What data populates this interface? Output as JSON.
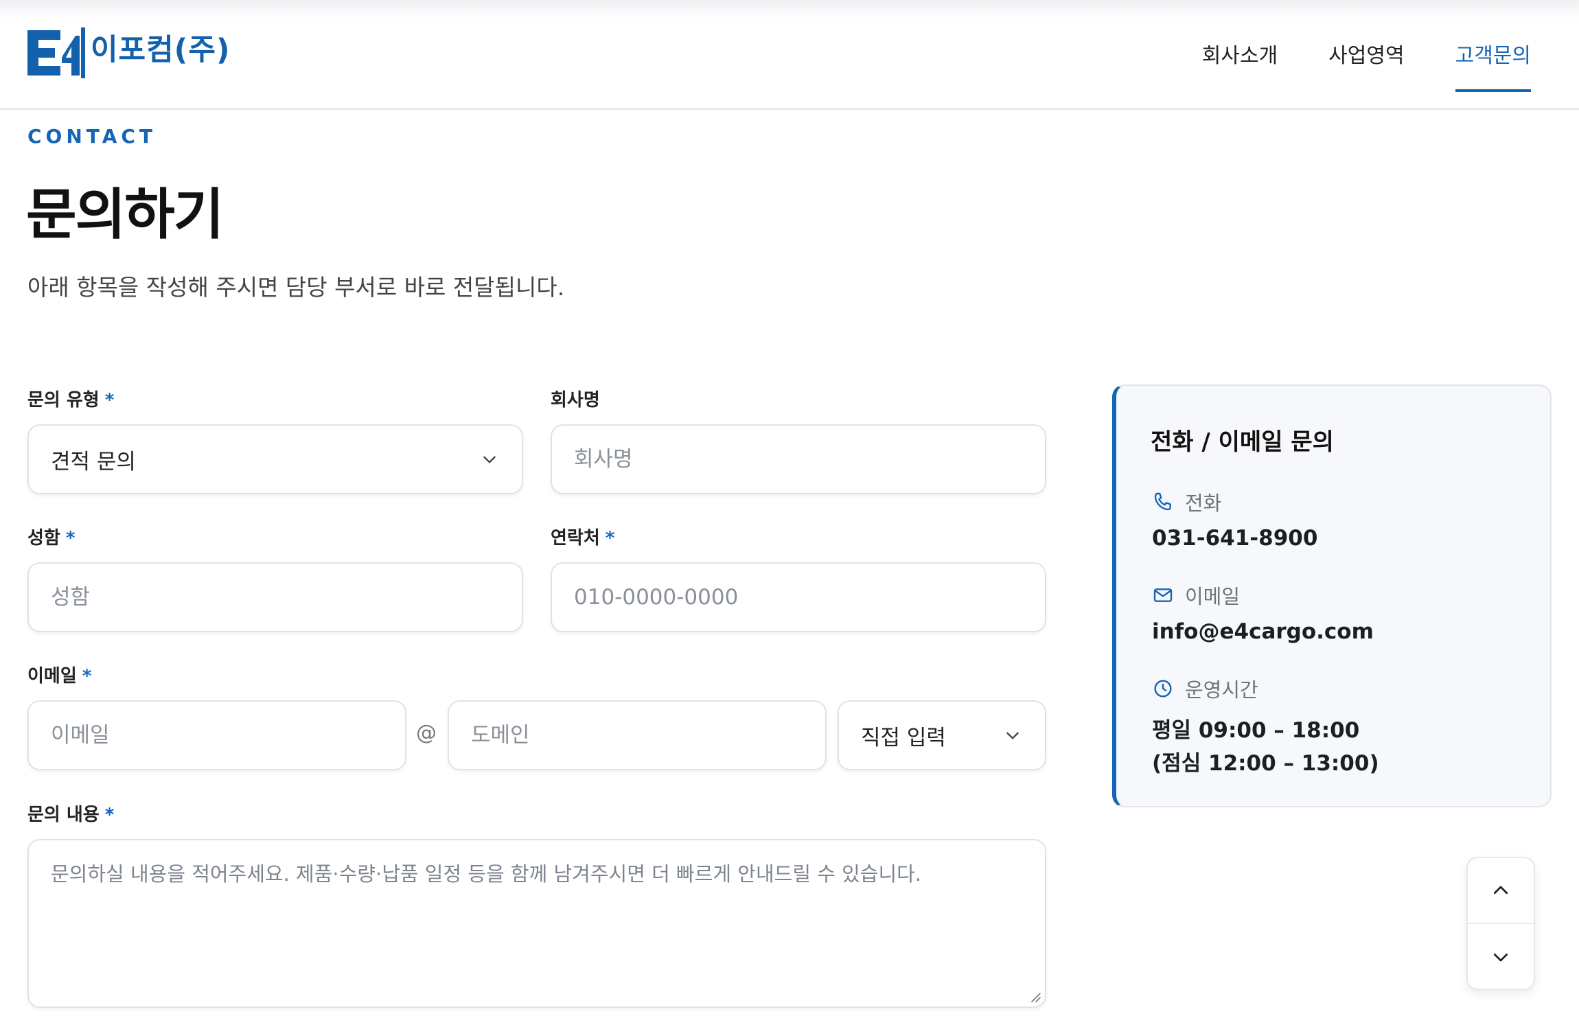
{
  "brand": {
    "name": "이포컴(주)",
    "primary_color": "#1565b7"
  },
  "nav": [
    {
      "label": "회사소개",
      "active": false
    },
    {
      "label": "사업영역",
      "active": false
    },
    {
      "label": "고객문의",
      "active": true
    }
  ],
  "page": {
    "eyebrow": "CONTACT",
    "title": "문의하기",
    "subtitle": "아래 항목을 작성해 주시면 담당 부서로 바로 전달됩니다."
  },
  "form": {
    "required_mark": "*",
    "inquiry_type": {
      "label": "문의 유형",
      "value": "견적 문의"
    },
    "company": {
      "label": "회사명",
      "placeholder": "회사명"
    },
    "name": {
      "label": "성함",
      "placeholder": "성함"
    },
    "phone": {
      "label": "연락처",
      "placeholder": "010-0000-0000"
    },
    "email": {
      "label": "이메일",
      "local_placeholder": "이메일",
      "at": "@",
      "domain_placeholder": "도메인",
      "domain_select_value": "직접 입력"
    },
    "message": {
      "label": "문의 내용",
      "placeholder": "문의하실 내용을 적어주세요. 제품·수량·납품 일정 등을 함께 남겨주시면 더 빠르게 안내드릴 수 있습니다."
    }
  },
  "contact_card": {
    "title": "전화 / 이메일 문의",
    "phone": {
      "icon": "phone-icon",
      "label": "전화",
      "value": "031-641-8900"
    },
    "email": {
      "icon": "mail-icon",
      "label": "이메일",
      "value": "info@e4cargo.com"
    },
    "hours": {
      "icon": "clock-icon",
      "label": "운영시간",
      "line1": "평일 09:00 – 18:00",
      "line2": "(점심 12:00 – 13:00)"
    }
  }
}
